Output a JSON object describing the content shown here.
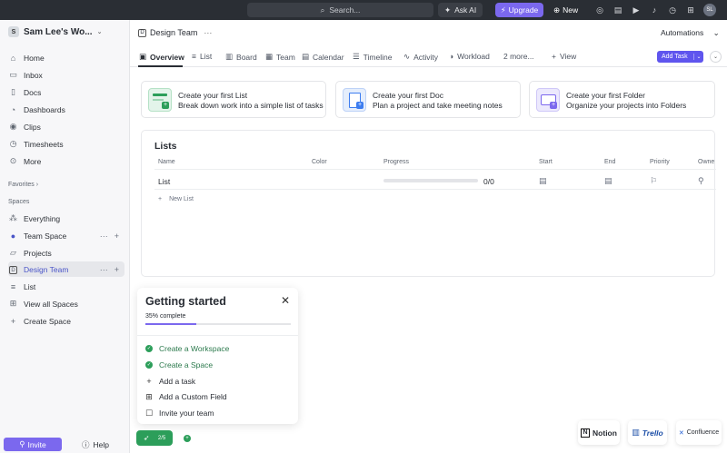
{
  "topbar": {
    "search_placeholder": "Search...",
    "ask_ai": "Ask AI",
    "upgrade": "Upgrade",
    "new": "New",
    "avatar_initials": "SL"
  },
  "sidebar": {
    "workspace_initial": "S",
    "workspace_name": "Sam Lee's Wo...",
    "nav": [
      "Home",
      "Inbox",
      "Docs",
      "Dashboards",
      "Clips",
      "Timesheets",
      "More"
    ],
    "favorites_label": "Favorites",
    "spaces_label": "Spaces",
    "spaces": {
      "everything": "Everything",
      "team_space": "Team Space",
      "projects": "Projects",
      "design_team_initial": "D",
      "design_team": "Design Team",
      "list": "List",
      "view_all": "View all Spaces",
      "create": "Create Space"
    },
    "invite": "Invite",
    "help": "Help"
  },
  "header": {
    "crumb_initial": "D",
    "crumb_title": "Design Team",
    "crumb_more": "···",
    "automations": "Automations",
    "tabs": [
      "Overview",
      "List",
      "Board",
      "Team",
      "Calendar",
      "Timeline",
      "Activity",
      "Workload",
      "2 more...",
      "View"
    ],
    "add_task": "Add Task"
  },
  "cards": [
    {
      "title": "Create your first List",
      "subtitle": "Break down work into a simple list of tasks",
      "color": "#2c9e5a"
    },
    {
      "title": "Create your first Doc",
      "subtitle": "Plan a project and take meeting notes",
      "color": "#3d7df0"
    },
    {
      "title": "Create your first Folder",
      "subtitle": "Organize your projects into Folders",
      "color": "#7b68ee"
    }
  ],
  "lists": {
    "title": "Lists",
    "columns": [
      "Name",
      "Color",
      "Progress",
      "Start",
      "End",
      "Priority",
      "Owne"
    ],
    "rows": [
      {
        "name": "List",
        "progress": "0/0",
        "progress_fraction": 0
      }
    ],
    "new_list": "New List"
  },
  "getting_started": {
    "title": "Getting started",
    "percent_label": "35% complete",
    "percent": 0.35,
    "items": [
      {
        "label": "Create a Workspace",
        "done": true
      },
      {
        "label": "Create a Space",
        "done": true
      },
      {
        "label": "Add a task",
        "done": false,
        "icon": "+"
      },
      {
        "label": "Add a Custom Field",
        "done": false,
        "icon": "⊞"
      },
      {
        "label": "Invite your team",
        "done": false,
        "icon": "☐"
      }
    ],
    "pill": "2/5"
  },
  "integrations": [
    {
      "name": "Notion"
    },
    {
      "name": "Trello"
    },
    {
      "name": "Confluence"
    }
  ]
}
